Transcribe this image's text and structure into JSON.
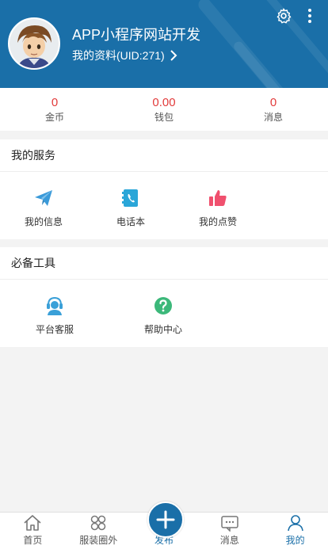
{
  "header": {
    "user_name": "APP小程序网站开发",
    "profile_link": "我的资料(UID:271)"
  },
  "stats": [
    {
      "value": "0",
      "label": "金币"
    },
    {
      "value": "0.00",
      "label": "钱包"
    },
    {
      "value": "0",
      "label": "消息"
    }
  ],
  "services": {
    "title": "我的服务",
    "items": [
      {
        "label": "我的信息",
        "icon": "paper-plane-icon"
      },
      {
        "label": "电话本",
        "icon": "phonebook-icon"
      },
      {
        "label": "我的点赞",
        "icon": "thumbs-up-icon"
      }
    ]
  },
  "tools": {
    "title": "必备工具",
    "items": [
      {
        "label": "平台客服",
        "icon": "customer-service-icon"
      },
      {
        "label": "帮助中心",
        "icon": "help-icon"
      }
    ]
  },
  "tabbar": {
    "items": [
      {
        "label": "首页",
        "icon": "home-icon"
      },
      {
        "label": "服装圈外",
        "icon": "clover-icon"
      },
      {
        "label": "发布",
        "icon": "plus-icon"
      },
      {
        "label": "消息",
        "icon": "chat-icon"
      },
      {
        "label": "我的",
        "icon": "user-icon"
      }
    ],
    "active": "我的"
  },
  "colors": {
    "brand": "#1a6fa8",
    "stat_value": "#e23b3b",
    "paper_plane": "#3a9ad9",
    "phonebook": "#2aa6d8",
    "thumbs_up": "#f0506e",
    "customer_service": "#3aa0d8",
    "help": "#3cb87a"
  }
}
